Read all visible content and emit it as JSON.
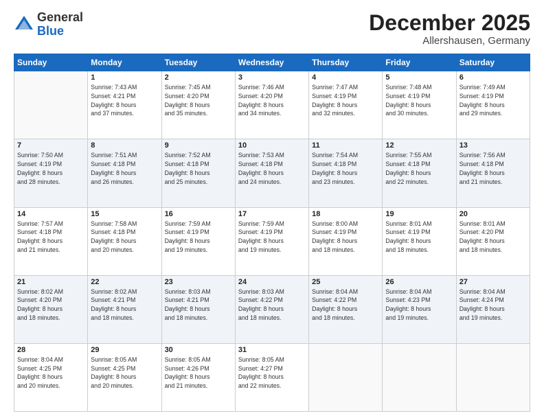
{
  "logo": {
    "general": "General",
    "blue": "Blue"
  },
  "title": "December 2025",
  "subtitle": "Allershausen, Germany",
  "days_of_week": [
    "Sunday",
    "Monday",
    "Tuesday",
    "Wednesday",
    "Thursday",
    "Friday",
    "Saturday"
  ],
  "weeks": [
    [
      {
        "day": "",
        "info": ""
      },
      {
        "day": "1",
        "info": "Sunrise: 7:43 AM\nSunset: 4:21 PM\nDaylight: 8 hours\nand 37 minutes."
      },
      {
        "day": "2",
        "info": "Sunrise: 7:45 AM\nSunset: 4:20 PM\nDaylight: 8 hours\nand 35 minutes."
      },
      {
        "day": "3",
        "info": "Sunrise: 7:46 AM\nSunset: 4:20 PM\nDaylight: 8 hours\nand 34 minutes."
      },
      {
        "day": "4",
        "info": "Sunrise: 7:47 AM\nSunset: 4:19 PM\nDaylight: 8 hours\nand 32 minutes."
      },
      {
        "day": "5",
        "info": "Sunrise: 7:48 AM\nSunset: 4:19 PM\nDaylight: 8 hours\nand 30 minutes."
      },
      {
        "day": "6",
        "info": "Sunrise: 7:49 AM\nSunset: 4:19 PM\nDaylight: 8 hours\nand 29 minutes."
      }
    ],
    [
      {
        "day": "7",
        "info": "Sunrise: 7:50 AM\nSunset: 4:19 PM\nDaylight: 8 hours\nand 28 minutes."
      },
      {
        "day": "8",
        "info": "Sunrise: 7:51 AM\nSunset: 4:18 PM\nDaylight: 8 hours\nand 26 minutes."
      },
      {
        "day": "9",
        "info": "Sunrise: 7:52 AM\nSunset: 4:18 PM\nDaylight: 8 hours\nand 25 minutes."
      },
      {
        "day": "10",
        "info": "Sunrise: 7:53 AM\nSunset: 4:18 PM\nDaylight: 8 hours\nand 24 minutes."
      },
      {
        "day": "11",
        "info": "Sunrise: 7:54 AM\nSunset: 4:18 PM\nDaylight: 8 hours\nand 23 minutes."
      },
      {
        "day": "12",
        "info": "Sunrise: 7:55 AM\nSunset: 4:18 PM\nDaylight: 8 hours\nand 22 minutes."
      },
      {
        "day": "13",
        "info": "Sunrise: 7:56 AM\nSunset: 4:18 PM\nDaylight: 8 hours\nand 21 minutes."
      }
    ],
    [
      {
        "day": "14",
        "info": "Sunrise: 7:57 AM\nSunset: 4:18 PM\nDaylight: 8 hours\nand 21 minutes."
      },
      {
        "day": "15",
        "info": "Sunrise: 7:58 AM\nSunset: 4:18 PM\nDaylight: 8 hours\nand 20 minutes."
      },
      {
        "day": "16",
        "info": "Sunrise: 7:59 AM\nSunset: 4:19 PM\nDaylight: 8 hours\nand 19 minutes."
      },
      {
        "day": "17",
        "info": "Sunrise: 7:59 AM\nSunset: 4:19 PM\nDaylight: 8 hours\nand 19 minutes."
      },
      {
        "day": "18",
        "info": "Sunrise: 8:00 AM\nSunset: 4:19 PM\nDaylight: 8 hours\nand 18 minutes."
      },
      {
        "day": "19",
        "info": "Sunrise: 8:01 AM\nSunset: 4:19 PM\nDaylight: 8 hours\nand 18 minutes."
      },
      {
        "day": "20",
        "info": "Sunrise: 8:01 AM\nSunset: 4:20 PM\nDaylight: 8 hours\nand 18 minutes."
      }
    ],
    [
      {
        "day": "21",
        "info": "Sunrise: 8:02 AM\nSunset: 4:20 PM\nDaylight: 8 hours\nand 18 minutes."
      },
      {
        "day": "22",
        "info": "Sunrise: 8:02 AM\nSunset: 4:21 PM\nDaylight: 8 hours\nand 18 minutes."
      },
      {
        "day": "23",
        "info": "Sunrise: 8:03 AM\nSunset: 4:21 PM\nDaylight: 8 hours\nand 18 minutes."
      },
      {
        "day": "24",
        "info": "Sunrise: 8:03 AM\nSunset: 4:22 PM\nDaylight: 8 hours\nand 18 minutes."
      },
      {
        "day": "25",
        "info": "Sunrise: 8:04 AM\nSunset: 4:22 PM\nDaylight: 8 hours\nand 18 minutes."
      },
      {
        "day": "26",
        "info": "Sunrise: 8:04 AM\nSunset: 4:23 PM\nDaylight: 8 hours\nand 19 minutes."
      },
      {
        "day": "27",
        "info": "Sunrise: 8:04 AM\nSunset: 4:24 PM\nDaylight: 8 hours\nand 19 minutes."
      }
    ],
    [
      {
        "day": "28",
        "info": "Sunrise: 8:04 AM\nSunset: 4:25 PM\nDaylight: 8 hours\nand 20 minutes."
      },
      {
        "day": "29",
        "info": "Sunrise: 8:05 AM\nSunset: 4:25 PM\nDaylight: 8 hours\nand 20 minutes."
      },
      {
        "day": "30",
        "info": "Sunrise: 8:05 AM\nSunset: 4:26 PM\nDaylight: 8 hours\nand 21 minutes."
      },
      {
        "day": "31",
        "info": "Sunrise: 8:05 AM\nSunset: 4:27 PM\nDaylight: 8 hours\nand 22 minutes."
      },
      {
        "day": "",
        "info": ""
      },
      {
        "day": "",
        "info": ""
      },
      {
        "day": "",
        "info": ""
      }
    ]
  ]
}
